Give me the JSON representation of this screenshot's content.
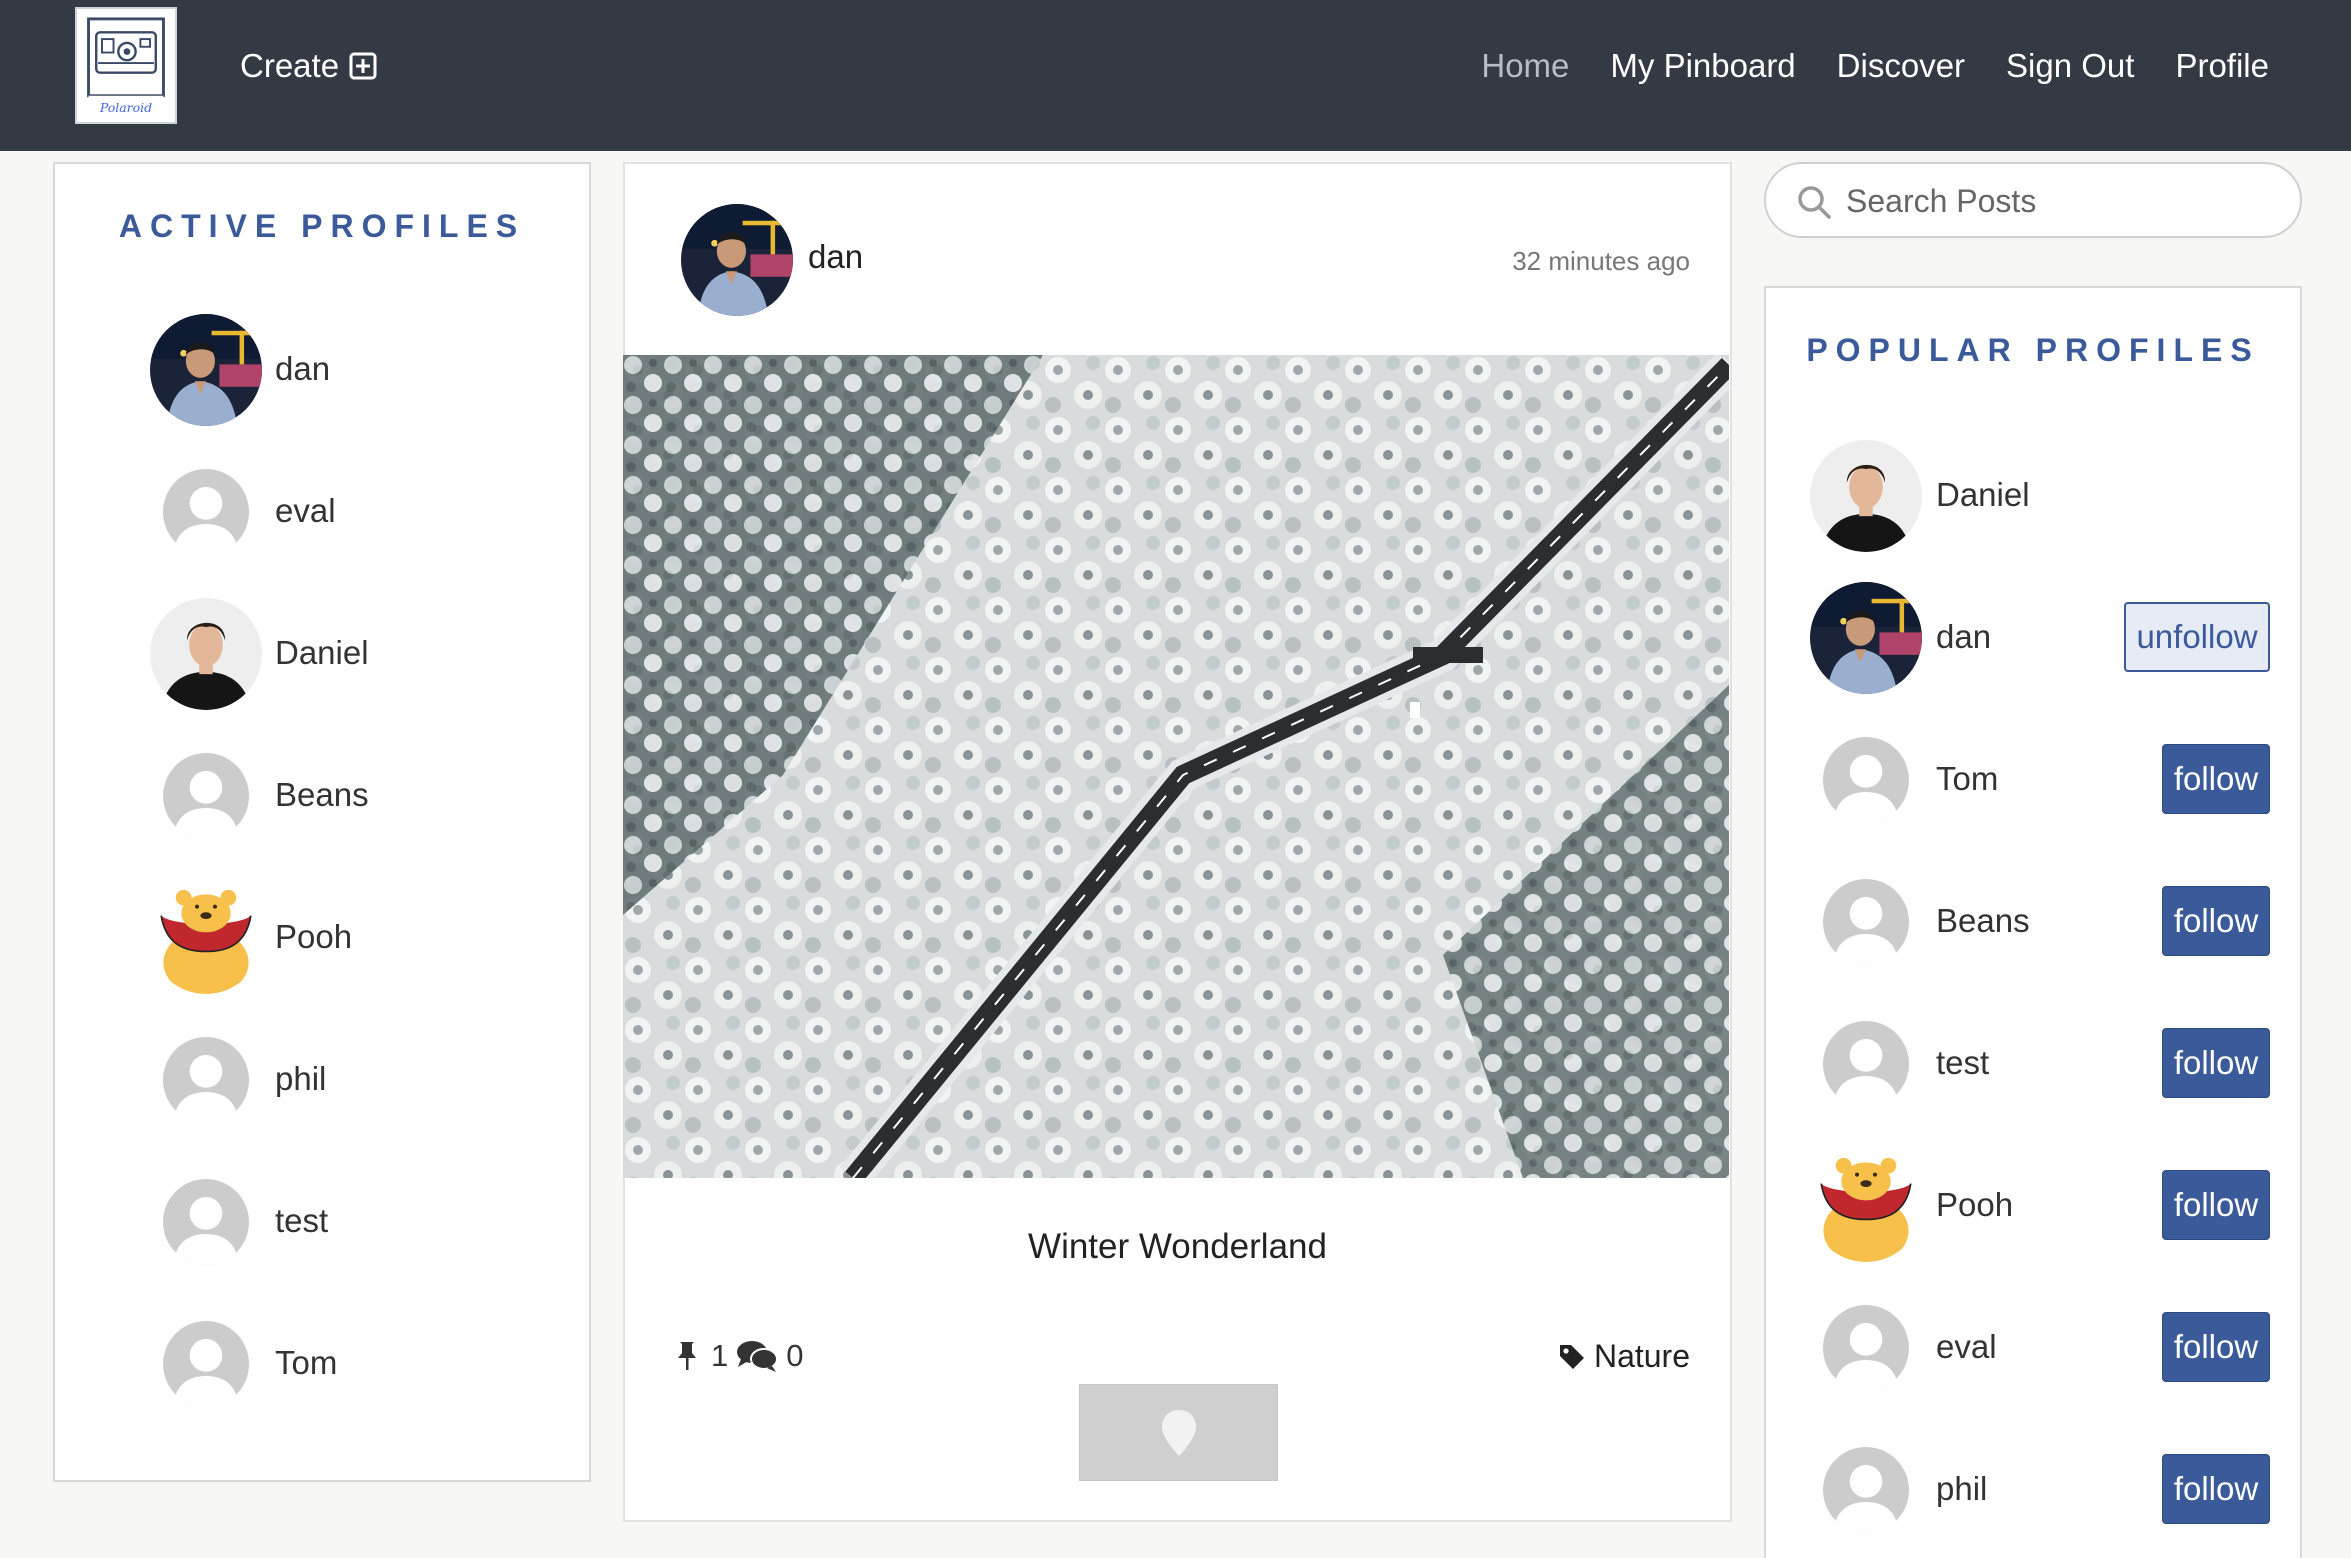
{
  "navbar": {
    "logo_text": "Polaroid",
    "create_label": "Create",
    "links": [
      {
        "label": "Home",
        "active": true
      },
      {
        "label": "My Pinboard"
      },
      {
        "label": "Discover"
      },
      {
        "label": "Sign Out"
      },
      {
        "label": "Profile"
      }
    ]
  },
  "active_profiles": {
    "title": "ACTIVE PROFILES",
    "items": [
      {
        "name": "dan",
        "avatar": "dan-photo"
      },
      {
        "name": "eval",
        "avatar": "generic-avatar"
      },
      {
        "name": "Daniel",
        "avatar": "daniel-photo"
      },
      {
        "name": "Beans",
        "avatar": "generic-avatar"
      },
      {
        "name": "Pooh",
        "avatar": "pooh-avatar"
      },
      {
        "name": "phil",
        "avatar": "generic-avatar"
      },
      {
        "name": "test",
        "avatar": "generic-avatar"
      },
      {
        "name": "Tom",
        "avatar": "generic-avatar"
      }
    ]
  },
  "post": {
    "author": "dan",
    "time": "32 minutes ago",
    "title": "Winter Wonderland",
    "pins": "1",
    "comments": "0",
    "tag": "Nature"
  },
  "search": {
    "placeholder": "Search Posts"
  },
  "popular_profiles": {
    "title": "POPULAR PROFILES",
    "items": [
      {
        "name": "Daniel",
        "avatar": "daniel-photo",
        "button": ""
      },
      {
        "name": "dan",
        "avatar": "dan-photo",
        "button": "unfollow"
      },
      {
        "name": "Tom",
        "avatar": "generic-avatar",
        "button": "follow"
      },
      {
        "name": "Beans",
        "avatar": "generic-avatar",
        "button": "follow"
      },
      {
        "name": "test",
        "avatar": "generic-avatar",
        "button": "follow"
      },
      {
        "name": "Pooh",
        "avatar": "pooh-avatar",
        "button": "follow"
      },
      {
        "name": "eval",
        "avatar": "generic-avatar",
        "button": "follow"
      },
      {
        "name": "phil",
        "avatar": "generic-avatar",
        "button": "follow"
      }
    ]
  },
  "colors": {
    "navbar": "#343a44",
    "accent": "#3b5a99",
    "background": "#f7f7f5"
  }
}
